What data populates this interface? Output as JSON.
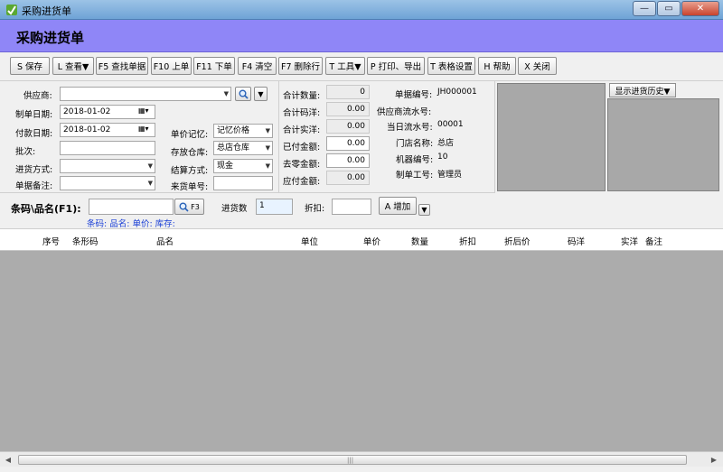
{
  "window": {
    "title": "采购进货单",
    "minimize": "—",
    "maximize": "▭",
    "close": "✕"
  },
  "header": {
    "title": "采购进货单"
  },
  "toolbar": {
    "buttons": [
      {
        "label": "S 保存"
      },
      {
        "label": "L 查看▼"
      },
      {
        "label": "F5 查找单据"
      },
      {
        "label": "F10 上单"
      },
      {
        "label": "F11 下单"
      },
      {
        "label": "F4 清空"
      },
      {
        "label": "F7 删除行"
      },
      {
        "label": "T 工具▼"
      },
      {
        "label": "P 打印、导出"
      },
      {
        "label": "T 表格设置"
      },
      {
        "label": "H 帮助"
      },
      {
        "label": "X 关闭"
      }
    ]
  },
  "form": {
    "supplier_label": "供应商:",
    "supplier_value": "",
    "create_date_label": "制单日期:",
    "create_date_value": "2018-01-02",
    "pay_date_label": "付款日期:",
    "pay_date_value": "2018-01-02",
    "batch_label": "批次:",
    "batch_value": "",
    "purchase_method_label": "进货方式:",
    "purchase_method_value": "",
    "remark_label": "单据备注:",
    "remark_value": "",
    "price_memory_label": "单价记忆:",
    "price_memory_value": "记忆价格",
    "warehouse_label": "存放仓库:",
    "warehouse_value": "总店仓库",
    "settle_label": "结算方式:",
    "settle_value": "现金",
    "incoming_no_label": "来货单号:",
    "incoming_no_value": ""
  },
  "totals": [
    {
      "label": "合计数量:",
      "value": "0"
    },
    {
      "label": "合计码洋:",
      "value": "0.00"
    },
    {
      "label": "合计实洋:",
      "value": "0.00"
    },
    {
      "label": "已付金额:",
      "value": "0.00"
    },
    {
      "label": "去零金额:",
      "value": "0.00"
    },
    {
      "label": "应付金额:",
      "value": "0.00"
    }
  ],
  "info": [
    {
      "label": "单据编号:",
      "value": "JH000001"
    },
    {
      "label": "供应商流水号:",
      "value": ""
    },
    {
      "label": "当日流水号:",
      "value": "00001"
    },
    {
      "label": "门店名称:",
      "value": "总店"
    },
    {
      "label": "机器编号:",
      "value": "10"
    },
    {
      "label": "制单工号:",
      "value": "管理员"
    }
  ],
  "history": {
    "button_label": "显示进货历史▼"
  },
  "barcode": {
    "label": "条码\\品名(F1):",
    "value": "",
    "search_button": "F3",
    "qty_label": "进货数",
    "qty_value": "1",
    "discount_label": "折扣:",
    "discount_value": "",
    "add_button": "A 增加",
    "hint": "条码: 品名: 单价: 库存:"
  },
  "grid": {
    "columns": [
      "序号",
      "条形码",
      "品名",
      "单位",
      "单价",
      "数量",
      "折扣",
      "折后价",
      "码洋",
      "实洋",
      "备注"
    ]
  },
  "colors": {
    "header_band": "#8f86f7",
    "grid_body": "#acacac",
    "hint_text": "#1a3fd6"
  }
}
